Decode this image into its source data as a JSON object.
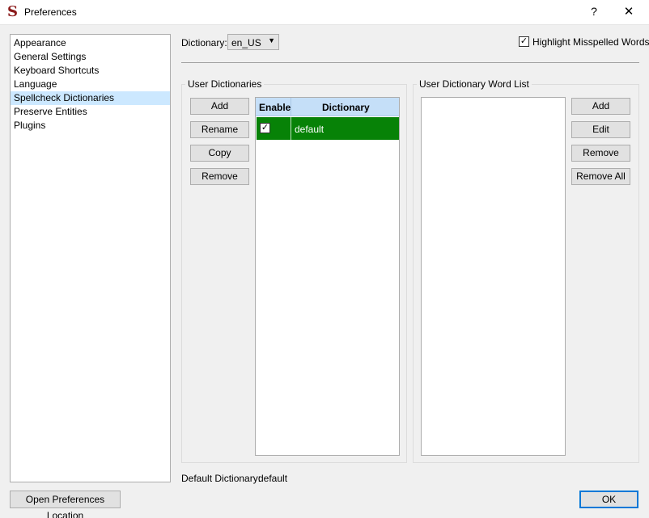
{
  "window": {
    "title": "Preferences",
    "app_icon": "S",
    "help_button": "?",
    "close_button": "✕"
  },
  "sidebar": {
    "items": [
      {
        "label": "Appearance"
      },
      {
        "label": "General Settings"
      },
      {
        "label": "Keyboard Shortcuts"
      },
      {
        "label": "Language"
      },
      {
        "label": "Spellcheck Dictionaries",
        "selected": true
      },
      {
        "label": "Preserve Entities"
      },
      {
        "label": "Plugins"
      }
    ],
    "open_location_button": "Open Preferences Location"
  },
  "dictionary": {
    "label": "Dictionary:",
    "selected": "en_US",
    "arrow": "▼"
  },
  "highlight": {
    "label": "Highlight Misspelled Words",
    "checked": true,
    "check_glyph": "✓"
  },
  "user_dictionaries": {
    "title": "User Dictionaries",
    "buttons": {
      "add": "Add",
      "rename": "Rename",
      "copy": "Copy",
      "remove": "Remove"
    },
    "table": {
      "headers": {
        "enable": "Enable",
        "dictionary": "Dictionary"
      },
      "rows": [
        {
          "enabled": true,
          "check_glyph": "✓",
          "name": "default"
        }
      ]
    }
  },
  "word_list": {
    "title": "User Dictionary Word List",
    "buttons": {
      "add": "Add",
      "edit": "Edit",
      "remove": "Remove",
      "remove_all": "Remove All"
    }
  },
  "default_dictionary": {
    "label": "Default Dictionary:",
    "value": "default"
  },
  "footer": {
    "ok_button": "OK"
  },
  "colors": {
    "selected_row": "#078207",
    "header_bg": "#c5dff8",
    "sidebar_selected": "#cce8ff",
    "ok_border": "#0078d7"
  }
}
